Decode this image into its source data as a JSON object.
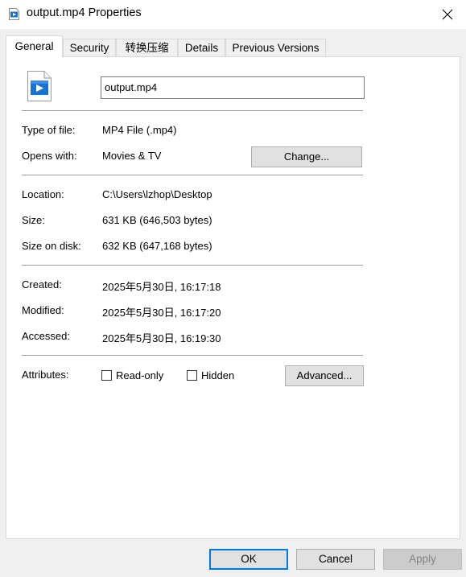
{
  "window": {
    "title": "output.mp4 Properties",
    "close_icon": "close-icon"
  },
  "tabs": [
    {
      "label": "General",
      "active": true
    },
    {
      "label": "Security",
      "active": false
    },
    {
      "label": "转换压缩",
      "active": false
    },
    {
      "label": "Details",
      "active": false
    },
    {
      "label": "Previous Versions",
      "active": false
    }
  ],
  "general": {
    "file_name": "output.mp4",
    "type_label": "Type of file:",
    "type_value": "MP4 File (.mp4)",
    "opens_label": "Opens with:",
    "opens_value": "Movies & TV",
    "change_button": "Change...",
    "location_label": "Location:",
    "location_value": "C:\\Users\\lzhop\\Desktop",
    "size_label": "Size:",
    "size_value": "631 KB (646,503 bytes)",
    "size_on_disk_label": "Size on disk:",
    "size_on_disk_value": "632 KB (647,168 bytes)",
    "created_label": "Created:",
    "created_value": "2025年5月30日, 16:17:18",
    "modified_label": "Modified:",
    "modified_value": "2025年5月30日, 16:17:20",
    "accessed_label": "Accessed:",
    "accessed_value": "2025年5月30日, 16:19:30",
    "attributes_label": "Attributes:",
    "readonly_label": "Read-only",
    "readonly_checked": false,
    "hidden_label": "Hidden",
    "hidden_checked": false,
    "advanced_button": "Advanced..."
  },
  "footer": {
    "ok": "OK",
    "cancel": "Cancel",
    "apply": "Apply"
  },
  "colors": {
    "accent": "#0078d7",
    "window_bg": "#f0f0f0",
    "panel_bg": "#ffffff"
  }
}
